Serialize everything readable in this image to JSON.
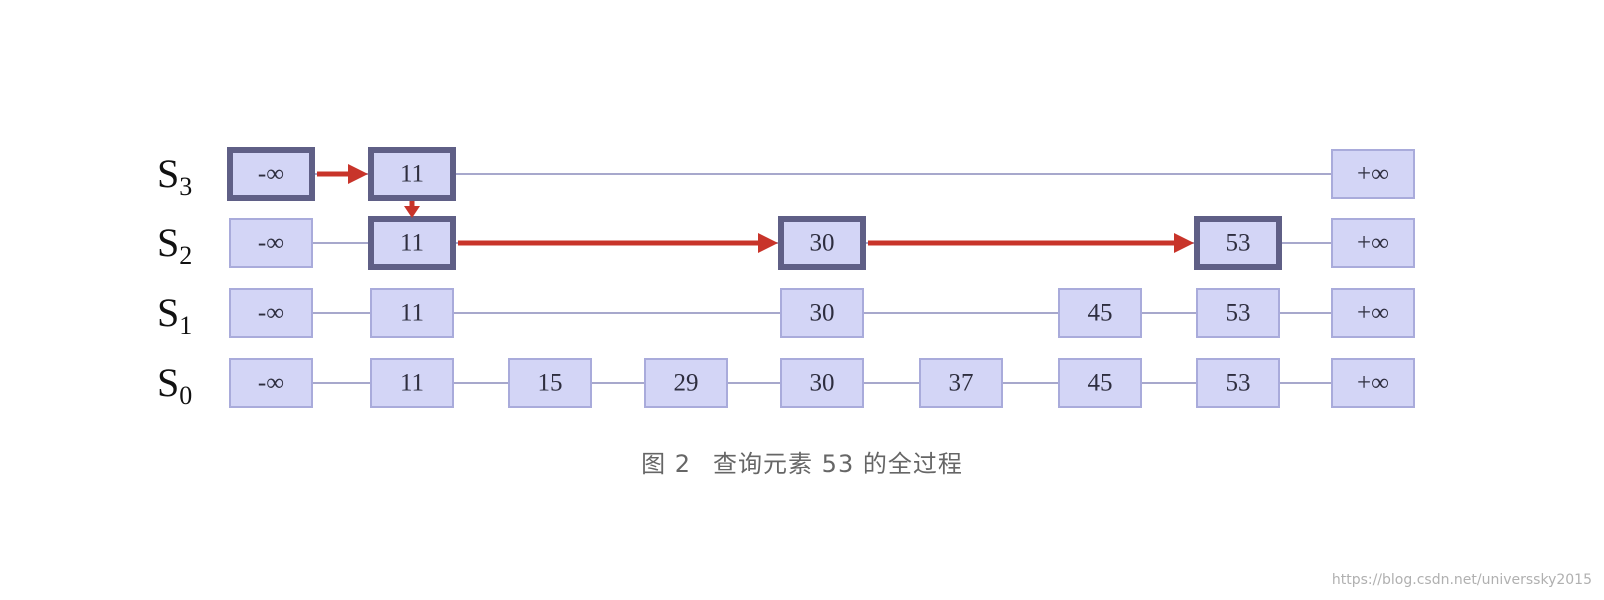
{
  "diagram": {
    "levels": [
      {
        "id": "S3",
        "label": "S",
        "subscript": "3",
        "nodes": [
          {
            "value": "-∞",
            "col": 0,
            "on_path": true
          },
          {
            "value": "11",
            "col": 1,
            "on_path": true
          },
          {
            "value": "+∞",
            "col": 8,
            "on_path": false
          }
        ]
      },
      {
        "id": "S2",
        "label": "S",
        "subscript": "2",
        "nodes": [
          {
            "value": "-∞",
            "col": 0,
            "on_path": false
          },
          {
            "value": "11",
            "col": 1,
            "on_path": true
          },
          {
            "value": "30",
            "col": 4,
            "on_path": true
          },
          {
            "value": "53",
            "col": 7,
            "on_path": true
          },
          {
            "value": "+∞",
            "col": 8,
            "on_path": false
          }
        ]
      },
      {
        "id": "S1",
        "label": "S",
        "subscript": "1",
        "nodes": [
          {
            "value": "-∞",
            "col": 0,
            "on_path": false
          },
          {
            "value": "11",
            "col": 1,
            "on_path": false
          },
          {
            "value": "30",
            "col": 4,
            "on_path": false
          },
          {
            "value": "45",
            "col": 6,
            "on_path": false
          },
          {
            "value": "53",
            "col": 7,
            "on_path": false
          },
          {
            "value": "+∞",
            "col": 8,
            "on_path": false
          }
        ]
      },
      {
        "id": "S0",
        "label": "S",
        "subscript": "0",
        "nodes": [
          {
            "value": "-∞",
            "col": 0,
            "on_path": false
          },
          {
            "value": "11",
            "col": 1,
            "on_path": false
          },
          {
            "value": "15",
            "col": 2,
            "on_path": false
          },
          {
            "value": "29",
            "col": 3,
            "on_path": false
          },
          {
            "value": "30",
            "col": 4,
            "on_path": false
          },
          {
            "value": "37",
            "col": 5,
            "on_path": false
          },
          {
            "value": "45",
            "col": 6,
            "on_path": false
          },
          {
            "value": "53",
            "col": 7,
            "on_path": false
          },
          {
            "value": "+∞",
            "col": 8,
            "on_path": false
          }
        ]
      }
    ],
    "search_path": [
      {
        "from": {
          "level": "S3",
          "col": 0
        },
        "to": {
          "level": "S3",
          "col": 1
        },
        "direction": "right"
      },
      {
        "from": {
          "level": "S3",
          "col": 1
        },
        "to": {
          "level": "S2",
          "col": 1
        },
        "direction": "down"
      },
      {
        "from": {
          "level": "S2",
          "col": 1
        },
        "to": {
          "level": "S2",
          "col": 4
        },
        "direction": "right"
      },
      {
        "from": {
          "level": "S2",
          "col": 4
        },
        "to": {
          "level": "S2",
          "col": 7
        },
        "direction": "right"
      }
    ],
    "colors": {
      "node_fill": "#d3d5f6",
      "node_border": "#a9abdb",
      "path_node_border": "#5f5f86",
      "link_line": "#a7a8cc",
      "search_arrow": "#c8342a"
    }
  },
  "caption": {
    "figure_number": "图 2",
    "text": "查询元素 53 的全过程"
  },
  "watermark": "https://blog.csdn.net/universsky2015"
}
